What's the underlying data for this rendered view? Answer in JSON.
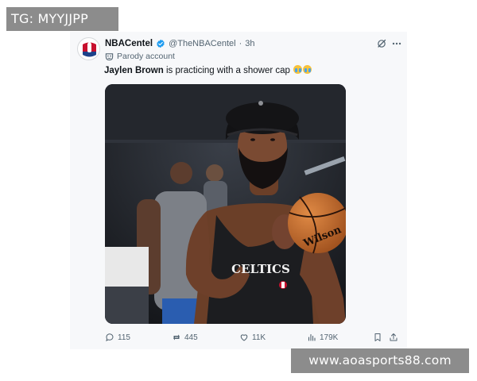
{
  "overlay": {
    "tg_label": "TG: MYYJJPP",
    "watermark_url": "www.aoasports88.com"
  },
  "tweet": {
    "display_name": "NBACentel",
    "handle": "@TheNBACentel",
    "separator": "·",
    "time": "3h",
    "parody_label": "Parody account",
    "text_bold": "Jaylen Brown",
    "text_rest": " is practicing with a shower cap",
    "emojis": [
      "loudly-crying-face",
      "loudly-crying-face"
    ],
    "media": {
      "jersey_text": "CELTICS",
      "ball_brand": "Wilson"
    },
    "actions": {
      "replies": "115",
      "reposts": "445",
      "likes": "11K",
      "views": "179K"
    }
  },
  "colors": {
    "verified_blue": "#1d9bf0",
    "secondary_text": "#536471",
    "overlay_gray": "#8c8c8c"
  }
}
